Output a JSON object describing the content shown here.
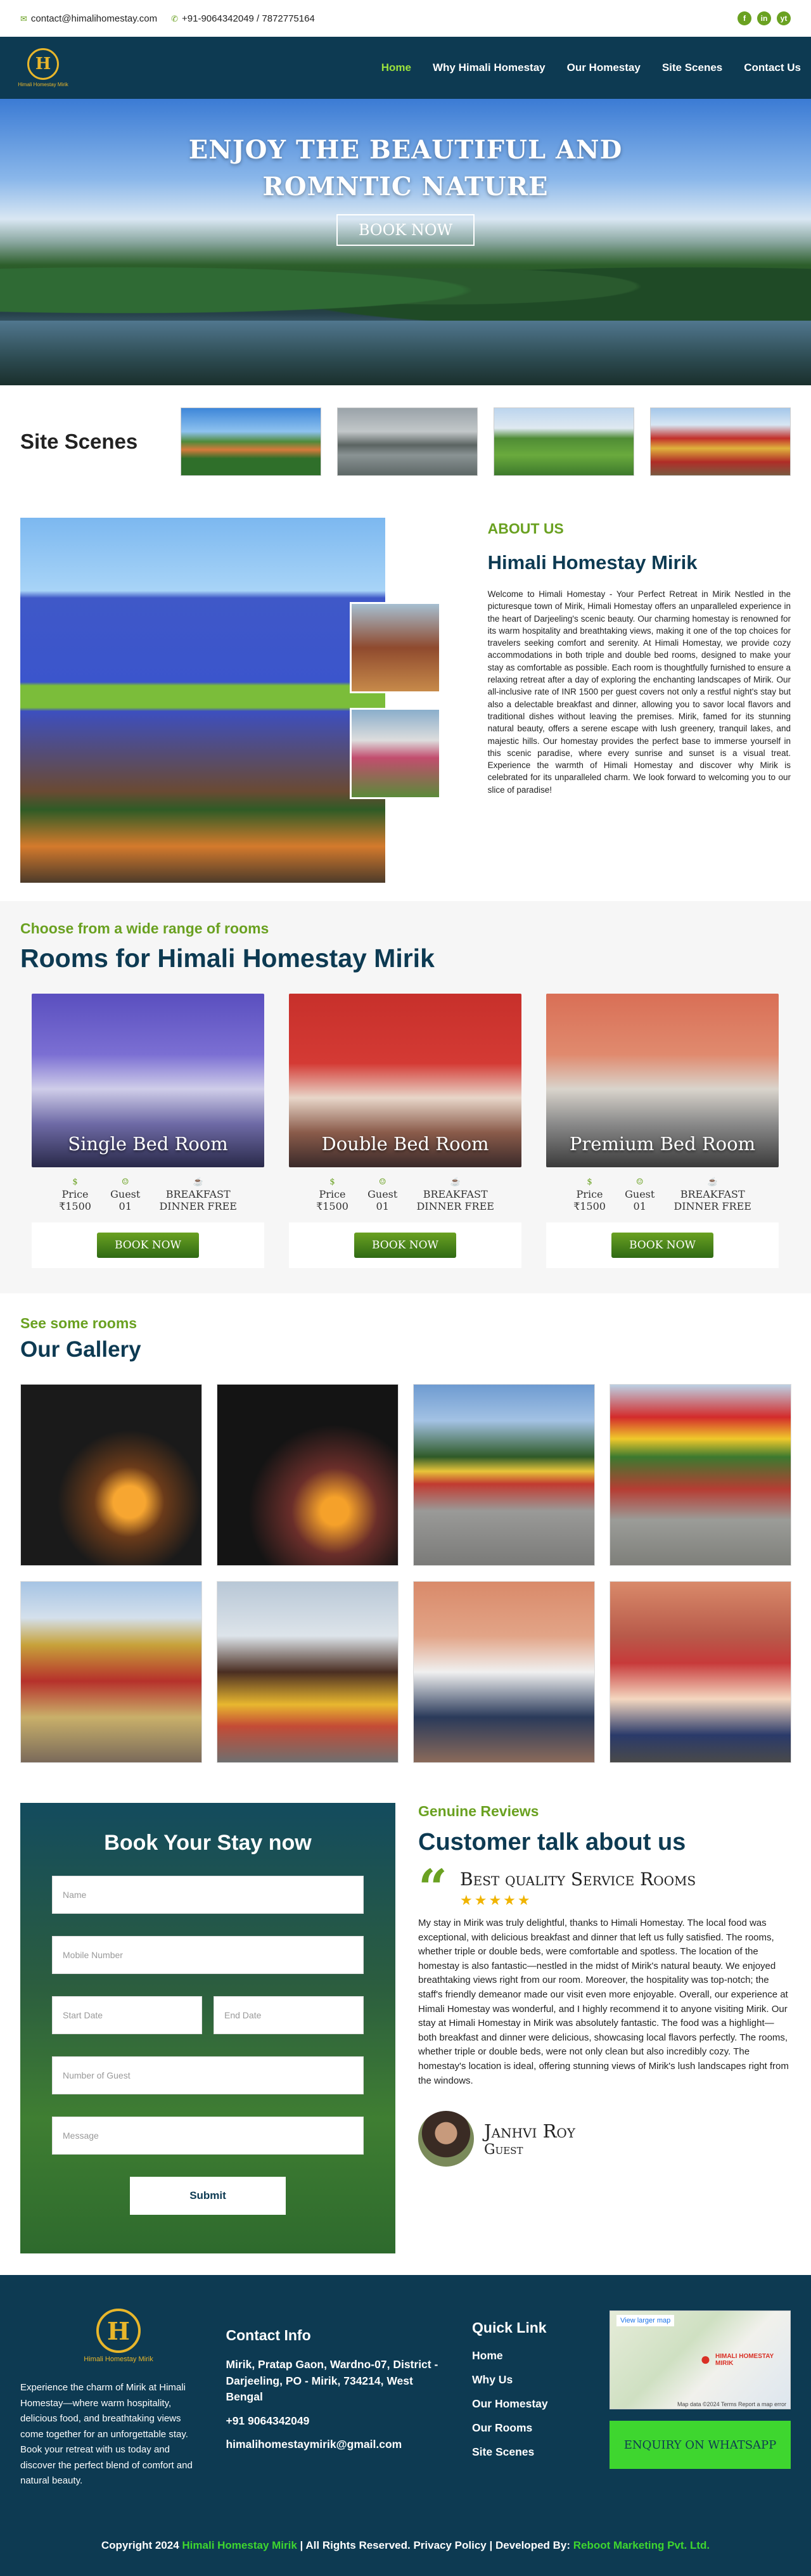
{
  "topbar": {
    "email": "contact@himalihomestay.com",
    "phone": "+91-9064342049 / 7872775164",
    "social": [
      "f",
      "in",
      "yt"
    ]
  },
  "nav": {
    "logo_text": "Himali Homestay Mirik",
    "logo_letter": "H",
    "items": [
      "Home",
      "Why Himali Homestay",
      "Our Homestay",
      "Site Scenes",
      "Contact Us"
    ]
  },
  "hero": {
    "title_line1": "Enjoy the beautiful and",
    "title_line2": "romntic nature",
    "button": "BOOK NOW"
  },
  "site_scenes": {
    "title": "Site Scenes"
  },
  "about": {
    "label": "ABOUT US",
    "title": "Himali Homestay Mirik",
    "body": "Welcome to Himali Homestay - Your Perfect Retreat in Mirik Nestled in the picturesque town of Mirik, Himali Homestay offers an unparalleled experience in the heart of Darjeeling's scenic beauty. Our charming homestay is renowned for its warm hospitality and breathtaking views, making it one of the top choices for travelers seeking comfort and serenity. At Himali Homestay, we provide cozy accommodations in both triple and double bed rooms, designed to make your stay as comfortable as possible. Each room is thoughtfully furnished to ensure a relaxing retreat after a day of exploring the enchanting landscapes of Mirik. Our all-inclusive rate of INR 1500 per guest covers not only a restful night's stay but also a delectable breakfast and dinner, allowing you to savor local flavors and traditional dishes without leaving the premises. Mirik, famed for its stunning natural beauty, offers a serene escape with lush greenery, tranquil lakes, and majestic hills. Our homestay provides the perfect base to immerse yourself in this scenic paradise, where every sunrise and sunset is a visual treat. Experience the warmth of Himali Homestay and discover why Mirik is celebrated for its unparalleled charm. We look forward to welcoming you to our slice of paradise!"
  },
  "rooms": {
    "label": "Choose from a wide range of rooms",
    "title": "Rooms for Himali Homestay Mirik",
    "items": [
      {
        "name": "Single Bed Room",
        "price_label": "Price",
        "price": "₹1500",
        "guest_label": "Guest",
        "guest": "01",
        "meal_label": "Breakfast",
        "meal": "Dinner Free",
        "button": "BOOK NOW"
      },
      {
        "name": "Double Bed Room",
        "price_label": "Price",
        "price": "₹1500",
        "guest_label": "Guest",
        "guest": "01",
        "meal_label": "Breakfast",
        "meal": "Dinner Free",
        "button": "BOOK NOW"
      },
      {
        "name": "Premium Bed Room",
        "price_label": "Price",
        "price": "₹1500",
        "guest_label": "Guest",
        "guest": "01",
        "meal_label": "Breakfast",
        "meal": "Dinner Free",
        "button": "BOOK NOW"
      }
    ]
  },
  "gallery": {
    "label": "See some rooms",
    "title": "Our Gallery"
  },
  "booking": {
    "title": "Book Your Stay now",
    "name_ph": "Name",
    "mobile_ph": "Mobile Number",
    "start_ph": "Start Date",
    "end_ph": "End Date",
    "guests_ph": "Number of Guest",
    "message_ph": "Message",
    "submit": "Submit"
  },
  "reviews": {
    "label": "Genuine Reviews",
    "title": "Customer talk about us",
    "quote_mark": "“",
    "review_title": "Best quality Service Rooms",
    "stars": "★★★★★",
    "text": "My stay in Mirik was truly delightful, thanks to Himali Homestay. The local food was exceptional, with delicious breakfast and dinner that left us fully satisfied. The rooms, whether triple or double beds, were comfortable and spotless. The location of the homestay is also fantastic—nestled in the midst of Mirik's natural beauty. We enjoyed breathtaking views right from our room. Moreover, the hospitality was top-notch; the staff's friendly demeanor made our visit even more enjoyable. Overall, our experience at Himali Homestay was wonderful, and I highly recommend it to anyone visiting Mirik. Our stay at Himali Homestay in Mirik was absolutely fantastic. The food was a highlight—both breakfast and dinner were delicious, showcasing local flavors perfectly. The rooms, whether triple or double beds, were not only clean but also incredibly cozy. The homestay's location is ideal, offering stunning views of Mirik's lush landscapes right from the windows.",
    "author": "Janhvi Roy",
    "role": "Guest"
  },
  "footer": {
    "about": "Experience the charm of Mirik at Himali Homestay—where warm hospitality, delicious food, and breathtaking views come together for an unforgettable stay. Book your retreat with us today and discover the perfect blend of comfort and natural beauty.",
    "contact_title": "Contact Info",
    "address": "Mirik, Pratap Gaon, Wardno-07, District - Darjeeling, PO - Mirik, 734214, West Bengal",
    "phone": "+91 9064342049",
    "email": "himalihomestaymirik@gmail.com",
    "links_title": "Quick Link",
    "links": [
      "Home",
      "Why Us",
      "Our Homestay",
      "Our Rooms",
      "Site Scenes"
    ],
    "map_link": "View larger map",
    "map_label": "HIMALI HOMESTAY MIRIK",
    "map_footer": "Map data ©2024  Terms  Report a map error",
    "whatsapp": "ENQUIRY ON WHATSAPP",
    "copy_prefix": "Copyright 2024",
    "copy_brand": "Himali Homestay Mirik",
    "copy_mid": "| All Rights Reserved. Privacy Policy | Developed By:",
    "copy_dev": "Reboot Marketing Pvt. Ltd."
  },
  "colors": {
    "brand_navy": "#0d3a52",
    "brand_green": "#6aa121",
    "whatsapp_green": "#3ed62f",
    "gold": "#e8b62b"
  }
}
